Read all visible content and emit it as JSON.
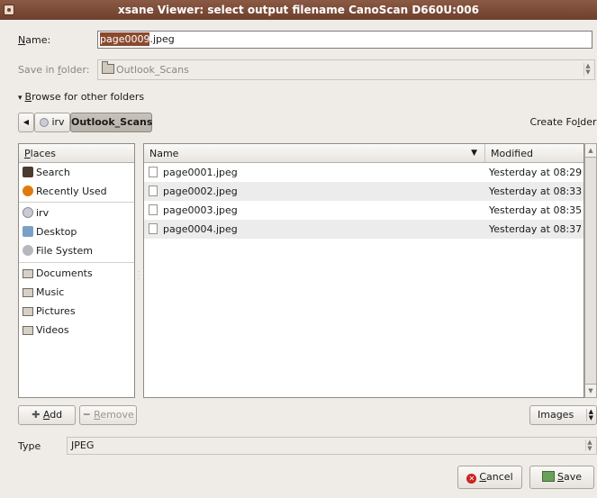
{
  "window": {
    "title": "xsane Viewer: select output filename CanoScan D660U:006"
  },
  "name": {
    "label_u": "N",
    "label_rest": "ame:",
    "selected": "page0009",
    "rest": ".jpeg"
  },
  "save_in": {
    "label_pre": "Save in ",
    "label_u": "f",
    "label_post": "older:",
    "value": "Outlook_Scans"
  },
  "browse": {
    "arrow": "▾",
    "label_u": "B",
    "label_rest": "rowse for other folders"
  },
  "path_bar": {
    "back": "◀",
    "items": [
      "irv",
      "Outlook_Scans"
    ]
  },
  "create_folder": {
    "pre": "Create Fo",
    "u": "l",
    "post": "der"
  },
  "places": {
    "header_u": "P",
    "header_rest": "laces",
    "items": [
      "Search",
      "Recently Used",
      "irv",
      "Desktop",
      "File System",
      "Documents",
      "Music",
      "Pictures",
      "Videos"
    ]
  },
  "files": {
    "columns": {
      "name": "Name",
      "modified": "Modified"
    },
    "sort_arrow": "▼",
    "rows": [
      {
        "name": "page0001.jpeg",
        "modified": "Yesterday at 08:29"
      },
      {
        "name": "page0002.jpeg",
        "modified": "Yesterday at 08:33"
      },
      {
        "name": "page0003.jpeg",
        "modified": "Yesterday at 08:35"
      },
      {
        "name": "page0004.jpeg",
        "modified": "Yesterday at 08:37"
      }
    ]
  },
  "buttons": {
    "add_u": "A",
    "add_rest": "dd",
    "remove_u": "R",
    "remove_rest": "emove",
    "filter": "Images",
    "cancel_u": "C",
    "cancel_rest": "ancel",
    "save_u": "S",
    "save_rest": "ave"
  },
  "type": {
    "label": "Type",
    "value": "JPEG"
  },
  "colors": {
    "titlebar": "#7a4a36",
    "selection": "#8a4a30"
  }
}
